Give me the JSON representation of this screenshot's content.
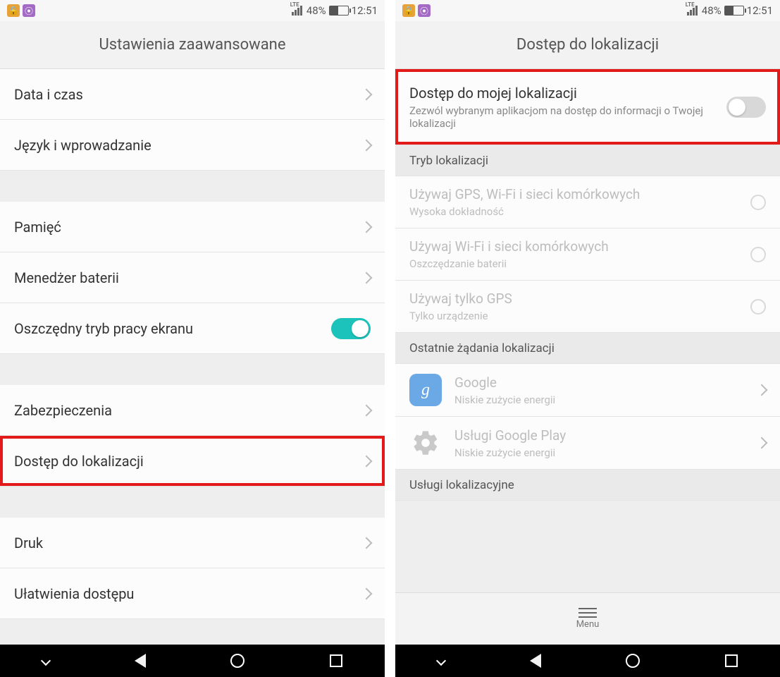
{
  "status": {
    "lte": "LTE",
    "battery_pct": "48%",
    "time": "12:51"
  },
  "left": {
    "title": "Ustawienia zaawansowane",
    "rows": {
      "date_time": "Data i czas",
      "lang_input": "Język i wprowadzanie",
      "memory": "Pamięć",
      "battery_mgr": "Menedżer baterii",
      "eco_screen": "Oszczędny tryb pracy ekranu",
      "security": "Zabezpieczenia",
      "location": "Dostęp do lokalizacji",
      "print": "Druk",
      "accessibility": "Ułatwienia dostępu"
    }
  },
  "right": {
    "title": "Dostęp do lokalizacji",
    "my_location": {
      "title": "Dostęp do mojej lokalizacji",
      "sub": "Zezwól wybranym aplikacjom na dostęp do informacji o Twojej lokalizacji"
    },
    "mode_header": "Tryb lokalizacji",
    "modes": {
      "high": {
        "title": "Używaj GPS, Wi-Fi i sieci komórkowych",
        "sub": "Wysoka dokładność"
      },
      "battery": {
        "title": "Używaj Wi-Fi i sieci komórkowych",
        "sub": "Oszczędzanie baterii"
      },
      "gps": {
        "title": "Używaj tylko GPS",
        "sub": "Tylko urządzenie"
      }
    },
    "recent_header": "Ostatnie żądania lokalizacji",
    "recent": {
      "google": {
        "title": "Google",
        "sub": "Niskie zużycie energii"
      },
      "gps_services": {
        "title": "Usługi Google Play",
        "sub": "Niskie zużycie energii"
      }
    },
    "services_header": "Usługi lokalizacyjne",
    "menu_label": "Menu"
  }
}
